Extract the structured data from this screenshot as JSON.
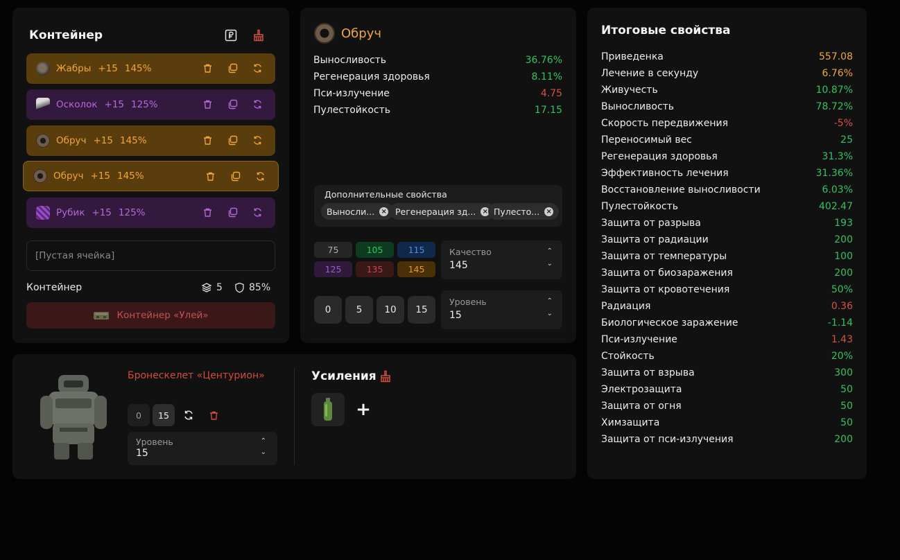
{
  "colors": {
    "positive": "#35c25f",
    "negative": "#d4524a",
    "highlight": "#f0a640"
  },
  "container": {
    "title": "Контейнер",
    "slots": [
      {
        "name": "Жабры",
        "level": "+15",
        "quality": "145%",
        "tier": "orange",
        "icon": "gills-artifact-icon"
      },
      {
        "name": "Осколок",
        "level": "+15",
        "quality": "125%",
        "tier": "purple",
        "icon": "shard-artifact-icon"
      },
      {
        "name": "Обруч",
        "level": "+15",
        "quality": "145%",
        "tier": "orange",
        "icon": "hoop-artifact-icon"
      },
      {
        "name": "Обруч",
        "level": "+15",
        "quality": "145%",
        "tier": "orange",
        "icon": "hoop-artifact-icon"
      },
      {
        "name": "Рубик",
        "level": "+15",
        "quality": "125%",
        "tier": "purple",
        "icon": "rubik-artifact-icon"
      }
    ],
    "empty_slot": "[Пустая ячейка]",
    "footer_label": "Контейнер",
    "capacity": "5",
    "protection": "85%",
    "container_button": "Контейнер «Улей»"
  },
  "artifact": {
    "name": "Обруч",
    "props": [
      {
        "name": "Выносливость",
        "value": "36.76%",
        "tone": "positive"
      },
      {
        "name": "Регенерация здоровья",
        "value": "8.11%",
        "tone": "positive"
      },
      {
        "name": "Пси-излучение",
        "value": "4.75",
        "tone": "negative"
      },
      {
        "name": "Пулестойкость",
        "value": "17.15",
        "tone": "positive"
      }
    ],
    "extra_title": "Дополнительные свойства",
    "extra_chips": [
      "Выносли...",
      "Регенерация зд...",
      "Пулесто..."
    ],
    "quality_buttons": [
      {
        "label": "75",
        "bg": "#262626",
        "fg": "#b0b0b0"
      },
      {
        "label": "105",
        "bg": "#0f3a22",
        "fg": "#34c45e"
      },
      {
        "label": "115",
        "bg": "#10284a",
        "fg": "#4a8fe0"
      },
      {
        "label": "125",
        "bg": "#301a3c",
        "fg": "#a05ccc"
      },
      {
        "label": "135",
        "bg": "#3a1818",
        "fg": "#c24a4a"
      },
      {
        "label": "145",
        "bg": "#4a3008",
        "fg": "#e89a2c"
      }
    ],
    "quality_label": "Качество",
    "quality_value": "145",
    "level_buttons": [
      "0",
      "5",
      "10",
      "15"
    ],
    "level_label": "Уровень",
    "level_value": "15"
  },
  "totals": {
    "title": "Итоговые свойства",
    "rows": [
      {
        "name": "Приведенка",
        "value": "557.08",
        "tone": "highlight"
      },
      {
        "name": "Лечение в секунду",
        "value": "6.76%",
        "tone": "highlight"
      },
      {
        "name": "Живучесть",
        "value": "10.87%",
        "tone": "positive"
      },
      {
        "name": "Выносливость",
        "value": "78.72%",
        "tone": "positive"
      },
      {
        "name": "Скорость передвижения",
        "value": "-5%",
        "tone": "negative"
      },
      {
        "name": "Переносимый вес",
        "value": "25",
        "tone": "positive"
      },
      {
        "name": "Регенерация здоровья",
        "value": "31.3%",
        "tone": "positive"
      },
      {
        "name": "Эффективность лечения",
        "value": "31.36%",
        "tone": "positive"
      },
      {
        "name": "Восстановление выносливости",
        "value": "6.03%",
        "tone": "positive"
      },
      {
        "name": "Пулестойкость",
        "value": "402.47",
        "tone": "positive"
      },
      {
        "name": "Защита от разрыва",
        "value": "193",
        "tone": "positive"
      },
      {
        "name": "Защита от радиации",
        "value": "200",
        "tone": "positive"
      },
      {
        "name": "Защита от температуры",
        "value": "100",
        "tone": "positive"
      },
      {
        "name": "Защита от биозаражения",
        "value": "200",
        "tone": "positive"
      },
      {
        "name": "Защита от кровотечения",
        "value": "50%",
        "tone": "positive"
      },
      {
        "name": "Радиация",
        "value": "0.36",
        "tone": "negative"
      },
      {
        "name": "Биологическое заражение",
        "value": "-1.14",
        "tone": "positive"
      },
      {
        "name": "Пси-излучение",
        "value": "1.43",
        "tone": "negative"
      },
      {
        "name": "Стойкость",
        "value": "20%",
        "tone": "positive"
      },
      {
        "name": "Защита от взрыва",
        "value": "300",
        "tone": "positive"
      },
      {
        "name": "Электрозащита",
        "value": "50",
        "tone": "positive"
      },
      {
        "name": "Защита от огня",
        "value": "50",
        "tone": "positive"
      },
      {
        "name": "Химзащита",
        "value": "50",
        "tone": "positive"
      },
      {
        "name": "Защита от пси-излучения",
        "value": "200",
        "tone": "positive"
      }
    ]
  },
  "suit": {
    "name": "Бронескелет «Центурион»",
    "level_buttons": [
      "0",
      "15"
    ],
    "level_label": "Уровень",
    "level_value": "15",
    "boosts_title": "Усиления",
    "add_symbol": "+"
  }
}
